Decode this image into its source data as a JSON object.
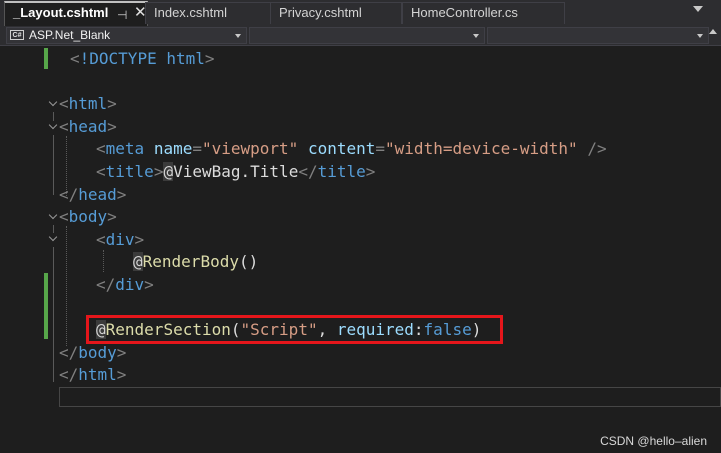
{
  "tabs": [
    {
      "label": "_Layout.cshtml",
      "active": true,
      "pin_glyph": "⊣",
      "close_glyph": "✕"
    },
    {
      "label": "Index.cshtml",
      "active": false
    },
    {
      "label": "Privacy.cshtml",
      "active": false
    },
    {
      "label": "HomeController.cs",
      "active": false
    }
  ],
  "navbar": {
    "project_icon": "C#",
    "project": "ASP.Net_Blank"
  },
  "code": {
    "doctype": {
      "open": "<",
      "text": "!DOCTYPE html",
      "close": ">"
    },
    "html_open": {
      "lt": "<",
      "name": "html",
      "gt": ">"
    },
    "head_open": {
      "lt": "<",
      "name": "head",
      "gt": ">"
    },
    "meta": {
      "lt": "<",
      "name": "meta",
      "attr1": "name",
      "eq1": "=",
      "val1": "\"viewport\"",
      "attr2": "content",
      "eq2": "=",
      "val2": "\"width=device-width\"",
      "end": "/>"
    },
    "title": {
      "lt": "<",
      "name": "title",
      "gt": ">",
      "at": "@",
      "expr": "ViewBag.Title",
      "close_lt": "</",
      "close_name": "title",
      "close_gt": ">"
    },
    "head_close": {
      "lt": "</",
      "name": "head",
      "gt": ">"
    },
    "body_open": {
      "lt": "<",
      "name": "body",
      "gt": ">"
    },
    "div_open": {
      "lt": "<",
      "name": "div",
      "gt": ">"
    },
    "render_body": {
      "at": "@",
      "call": "RenderBody",
      "parens": "()"
    },
    "div_close": {
      "lt": "</",
      "name": "div",
      "gt": ">"
    },
    "render_section": {
      "at": "@",
      "call": "RenderSection",
      "open": "(",
      "str": "\"Script\"",
      "comma": ", ",
      "param": "required",
      "colon": ":",
      "value": "false",
      "close": ")"
    },
    "body_close": {
      "lt": "</",
      "name": "body",
      "gt": ">"
    },
    "html_close": {
      "lt": "</",
      "name": "html",
      "gt": ">"
    }
  },
  "watermark": "CSDN @hello–alien",
  "colors": {
    "tag": "#569cd6",
    "attribute": "#9cdcfe",
    "string": "#d69d85",
    "razor_method": "#dcdcaa",
    "change_marker": "#57a64a",
    "highlight_box": "#e5161b"
  }
}
